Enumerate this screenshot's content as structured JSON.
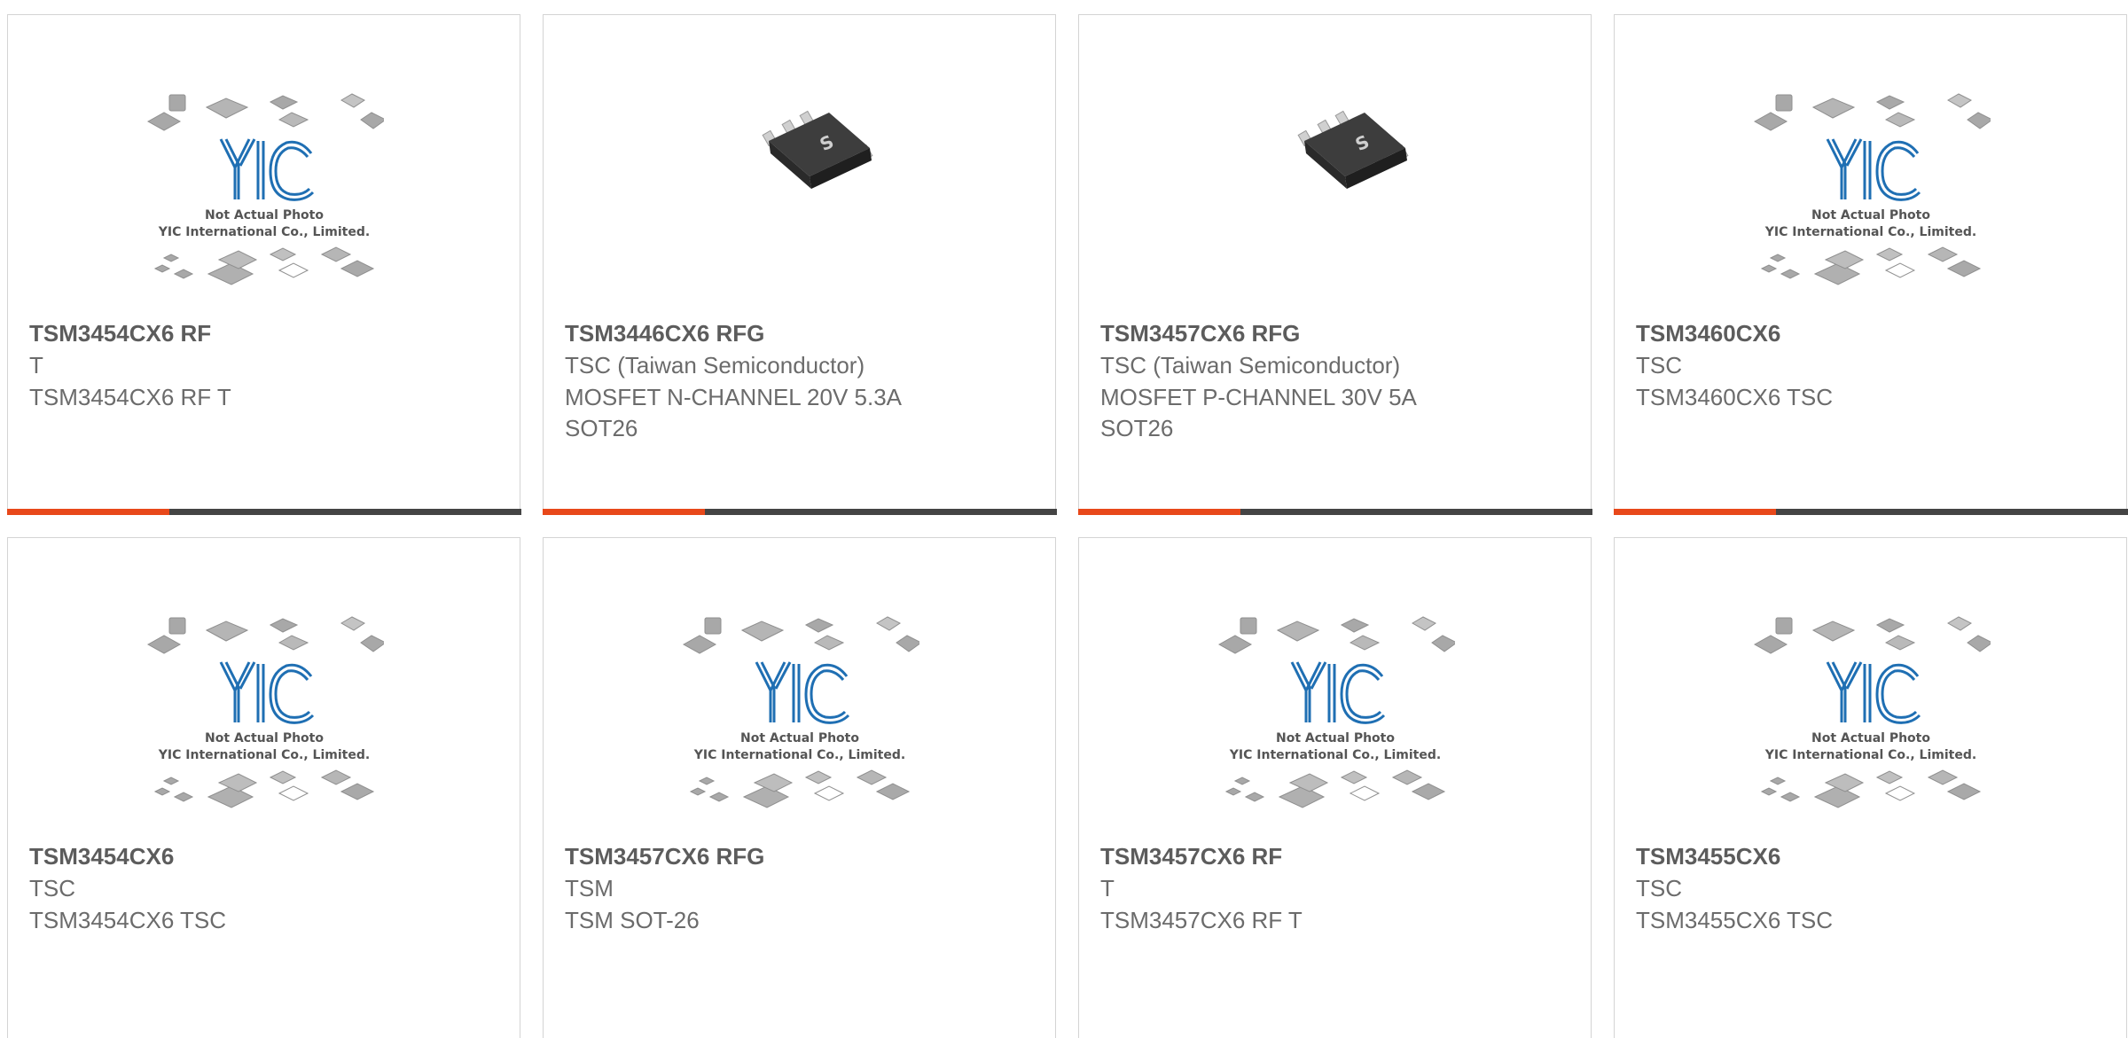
{
  "placeholder": {
    "line1": "Not Actual Photo",
    "line2": "YIC International Co., Limited.",
    "logo": "YIC"
  },
  "products": [
    {
      "title": "TSM3454CX6 RF",
      "lines": [
        "T",
        "TSM3454CX6 RF T"
      ],
      "image": "yic-placeholder"
    },
    {
      "title": "TSM3446CX6 RFG",
      "lines": [
        "TSC (Taiwan Semiconductor)",
        "MOSFET N-CHANNEL 20V 5.3A",
        "SOT26"
      ],
      "image": "sot26-chip"
    },
    {
      "title": "TSM3457CX6 RFG",
      "lines": [
        "TSC (Taiwan Semiconductor)",
        "MOSFET P-CHANNEL 30V 5A",
        "SOT26"
      ],
      "image": "sot26-chip"
    },
    {
      "title": "TSM3460CX6",
      "lines": [
        "TSC",
        "TSM3460CX6 TSC"
      ],
      "image": "yic-placeholder"
    },
    {
      "title": "TSM3454CX6",
      "lines": [
        "TSC",
        "TSM3454CX6 TSC"
      ],
      "image": "yic-placeholder"
    },
    {
      "title": "TSM3457CX6 RFG",
      "lines": [
        "TSM",
        "TSM SOT-26"
      ],
      "image": "yic-placeholder"
    },
    {
      "title": "TSM3457CX6 RF",
      "lines": [
        "T",
        "TSM3457CX6 RF T"
      ],
      "image": "yic-placeholder"
    },
    {
      "title": "TSM3455CX6",
      "lines": [
        "TSC",
        "TSM3455CX6 TSC"
      ],
      "image": "yic-placeholder"
    }
  ],
  "colors": {
    "accent_orange": "#e8481a",
    "accent_dark": "#444444",
    "logo_blue": "#1f6fb3",
    "title_text": "#5c5c5c",
    "body_text": "#6b6b6b"
  }
}
